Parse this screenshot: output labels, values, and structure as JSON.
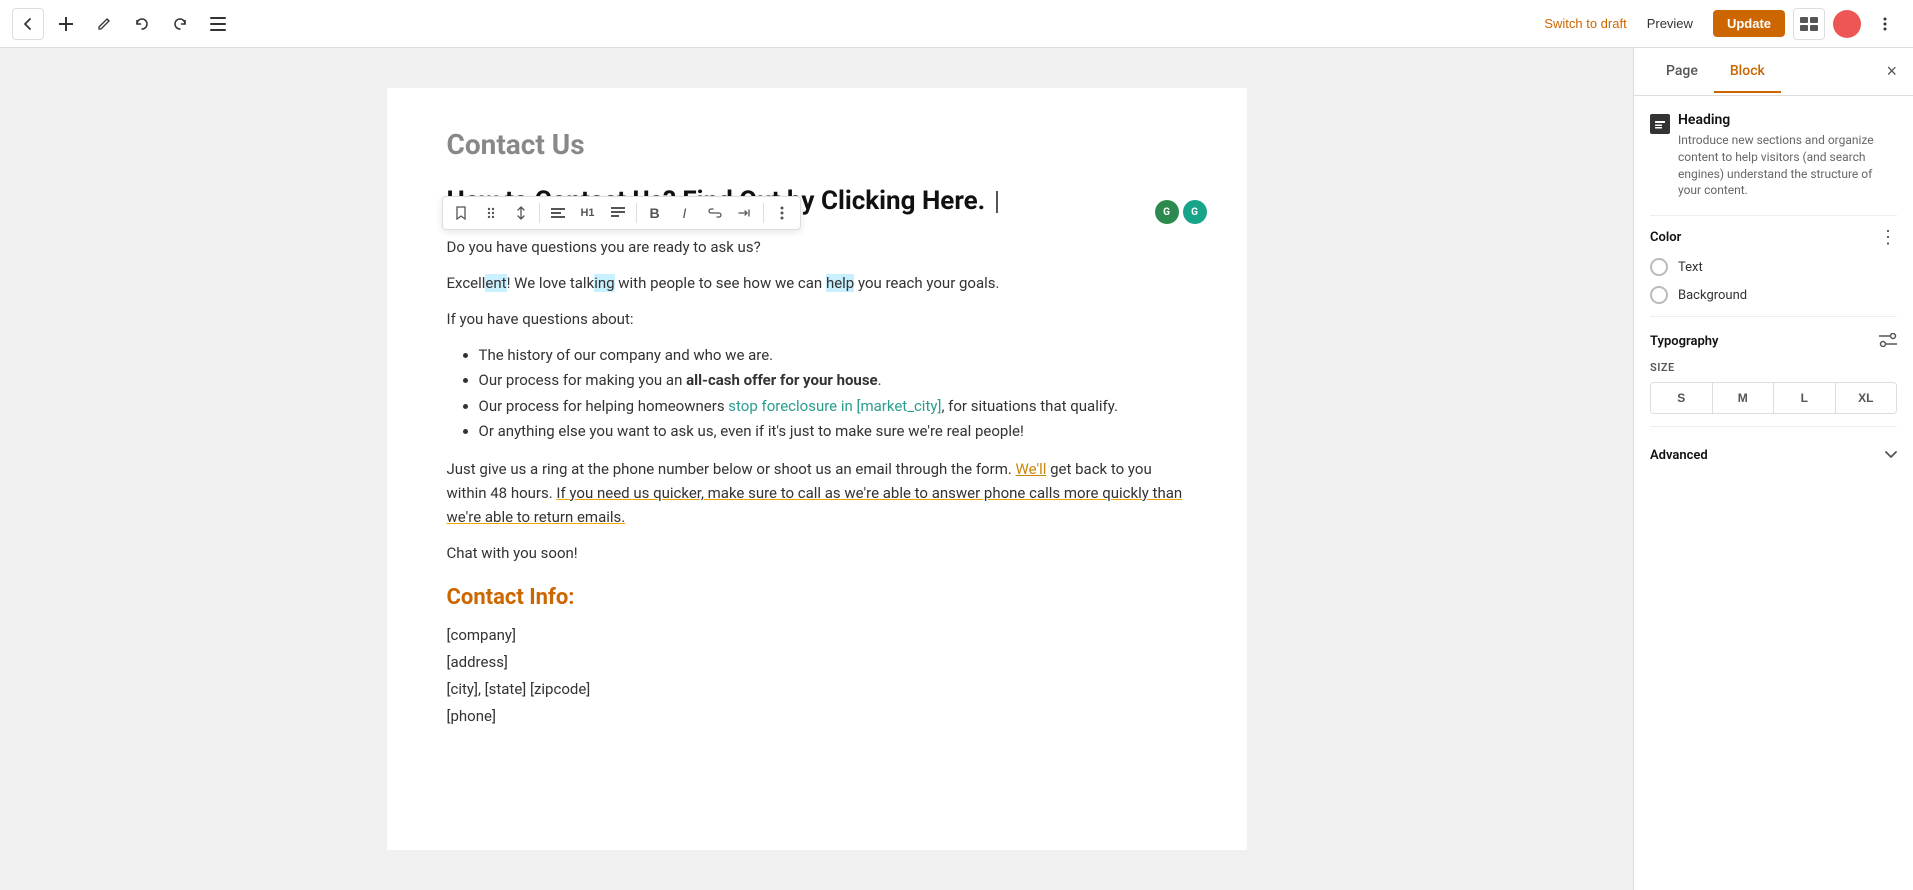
{
  "topbar": {
    "switch_draft": "Switch to draft",
    "preview": "Preview",
    "update": "Update"
  },
  "editor": {
    "contact_title": "Contact Us",
    "main_heading": "How to Contact Us? Find Out by Clicking Here.",
    "paragraph1": "Do you have questions you are ready to ask us?",
    "paragraph2": "Excellent! We love talking with people to see how we can help you reach your goals.",
    "paragraph3": "If you have questions about:",
    "bullet1": "The history of our company and who we are.",
    "bullet2_pre": "Our process for making you an ",
    "bullet2_bold": "all-cash offer for your house",
    "bullet2_post": ".",
    "bullet3_pre": "Our process for helping homeowners ",
    "bullet3_link": "stop foreclosure in [market_city]",
    "bullet3_post": ", for situations that qualify.",
    "bullet4": "Or anything else you want to ask us, even if it's just to make sure we're real people!",
    "paragraph4_pre": "Just give us a ring at the phone number below or shoot us an email through the form. ",
    "paragraph4_link": "We'll",
    "paragraph4_mid": " get back to you within 48 hours. ",
    "paragraph4_highlight": "If you need us quicker, make sure to call as we're able to answer phone calls more quickly than we're able to return emails.",
    "paragraph5": "Chat with you soon!",
    "contact_info_heading": "Contact Info:",
    "company": "[company]",
    "address": "[address]",
    "city_state_zip": "[city], [state] [zipcode]",
    "phone": "[phone]"
  },
  "panel": {
    "page_tab": "Page",
    "block_tab": "Block",
    "block_name": "Heading",
    "block_desc": "Introduce new sections and organize content to help visitors (and search engines) understand the structure of your content.",
    "color_section": "Color",
    "text_label": "Text",
    "background_label": "Background",
    "typography_section": "Typography",
    "size_label": "SIZE",
    "sizes": [
      "S",
      "M",
      "L",
      "XL"
    ],
    "advanced_label": "Advanced"
  }
}
